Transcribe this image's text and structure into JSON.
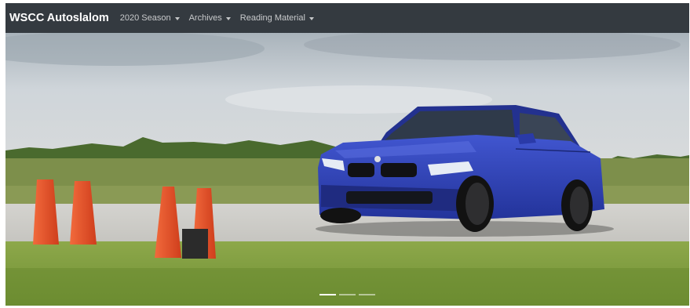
{
  "navbar": {
    "brand": "WSCC Autoslalom",
    "items": [
      {
        "label": "2020 Season"
      },
      {
        "label": "Archives"
      },
      {
        "label": "Reading Material"
      }
    ]
  },
  "carousel": {
    "indicators": [
      {
        "state": "active"
      },
      {
        "state": "inactive"
      },
      {
        "state": "inactive"
      }
    ]
  },
  "colors": {
    "navbar_bg": "#343a40",
    "car": "#2d40b4",
    "cone": "#e8502a",
    "grass": "#7a9a3a",
    "sky": "#c9d0d6"
  }
}
